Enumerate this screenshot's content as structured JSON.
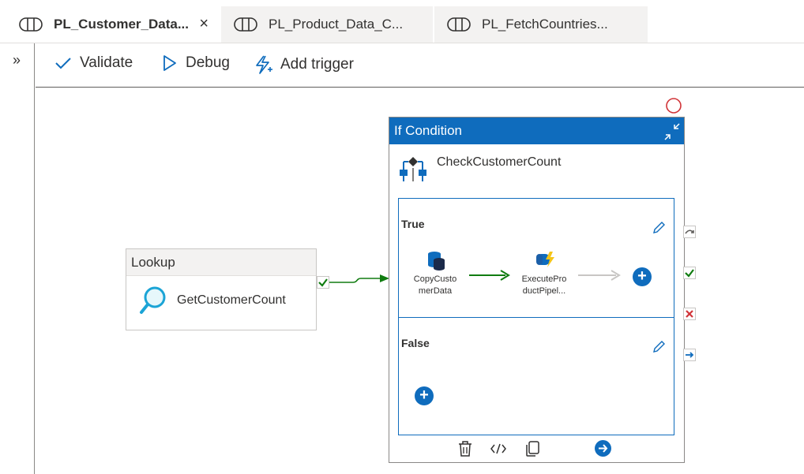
{
  "tabs": [
    {
      "label": "PL_Customer_Data...",
      "active": true,
      "close": "×"
    },
    {
      "label": "PL_Product_Data_C...",
      "active": false
    },
    {
      "label": "PL_FetchCountries...",
      "active": false
    }
  ],
  "rail": {
    "expand": "»"
  },
  "toolbar": {
    "validate": "Validate",
    "debug": "Debug",
    "add_trigger": "Add trigger"
  },
  "lookup": {
    "header": "Lookup",
    "name": "GetCustomerCount"
  },
  "if_condition": {
    "header": "If Condition",
    "name": "CheckCustomerCount"
  },
  "branches": {
    "true_label": "True",
    "false_label": "False"
  },
  "true_activities": {
    "copy": "CopyCustomerData",
    "execute": "ExecuteProductPipel..."
  },
  "colors": {
    "accent": "#0f6cbd",
    "success": "#107c10",
    "fail": "#d13438",
    "tab_inactive_bg": "#f3f2f1"
  },
  "icons": [
    "pipeline-icon",
    "close-icon",
    "chevron-double-right-icon",
    "checkmark-icon",
    "play-icon",
    "trigger-icon",
    "search-icon",
    "collapse-icon",
    "if-condition-icon",
    "edit-icon",
    "copy-data-icon",
    "execute-pipeline-icon",
    "add-icon",
    "delete-icon",
    "code-icon",
    "clone-icon",
    "go-icon",
    "skip-icon",
    "success-icon",
    "failure-icon",
    "completion-icon"
  ]
}
